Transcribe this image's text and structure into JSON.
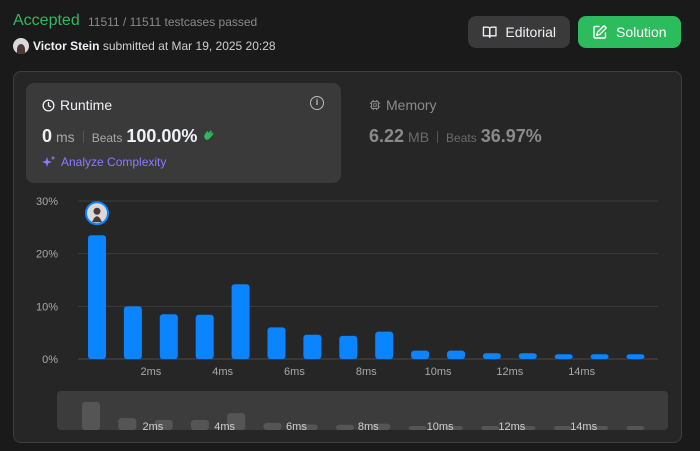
{
  "header": {
    "status": "Accepted",
    "testcases": "11511 / 11511 testcases passed",
    "submitter_name": "Victor Stein",
    "submitted_text": "submitted at Mar 19, 2025 20:28",
    "editorial_label": "Editorial",
    "solution_label": "Solution"
  },
  "runtime": {
    "title": "Runtime",
    "value": "0",
    "unit": "ms",
    "beats_label": "Beats",
    "beats_pct": "100.00%",
    "analyze_label": "Analyze Complexity"
  },
  "memory": {
    "title": "Memory",
    "value": "6.22",
    "unit": "MB",
    "beats_label": "Beats",
    "beats_pct": "36.97%"
  },
  "colors": {
    "accepted": "#2cbb5d",
    "bar": "#0a84ff",
    "mini_bar": "#555555"
  },
  "chart_data": {
    "type": "bar",
    "y_tick_labels": [
      "30%",
      "20%",
      "10%",
      "0%"
    ],
    "ylim": [
      0,
      30
    ],
    "x_tick_labels": [
      "2ms",
      "4ms",
      "6ms",
      "8ms",
      "10ms",
      "12ms",
      "14ms"
    ],
    "categories": [
      "0ms",
      "1ms",
      "2ms",
      "3ms",
      "4ms",
      "5ms",
      "6ms",
      "7ms",
      "8ms",
      "9ms",
      "10ms",
      "11ms",
      "12ms",
      "13ms",
      "14ms",
      "15ms"
    ],
    "values": [
      23.5,
      10.0,
      8.5,
      8.4,
      14.2,
      6.0,
      4.6,
      4.4,
      5.2,
      1.6,
      1.6,
      1.1,
      1.1,
      0.9,
      0.9,
      0.9
    ],
    "grid": true,
    "highlight_index": 0
  }
}
